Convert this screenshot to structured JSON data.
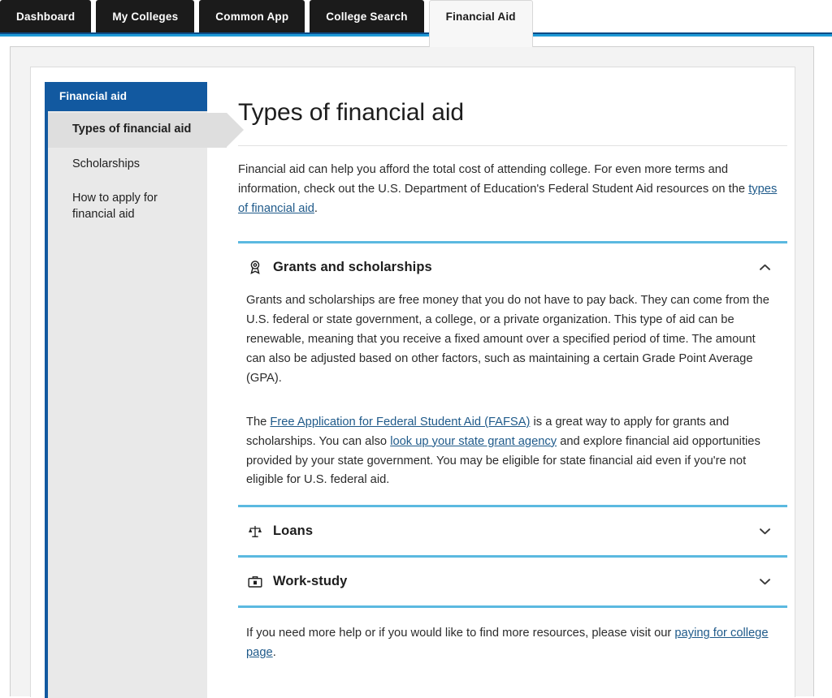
{
  "tabs": [
    {
      "label": "Dashboard",
      "active": false
    },
    {
      "label": "My Colleges",
      "active": false
    },
    {
      "label": "Common App",
      "active": false
    },
    {
      "label": "College Search",
      "active": false
    },
    {
      "label": "Financial Aid",
      "active": true
    }
  ],
  "sidebar": {
    "header": "Financial aid",
    "items": [
      {
        "label": "Types of financial aid",
        "active": true
      },
      {
        "label": "Scholarships",
        "active": false
      },
      {
        "label": "How to apply for financial aid",
        "active": false
      }
    ]
  },
  "main": {
    "title": "Types of financial aid",
    "intro": {
      "before": "Financial aid can help you afford the total cost of attending college. For even more terms and information, check out the U.S. Department of Education's Federal Student Aid resources on the ",
      "link": "types of financial aid",
      "after": "."
    },
    "accordion": [
      {
        "id": "grants-and-scholarships",
        "title": "Grants and scholarships",
        "icon": "award-medal-icon",
        "expanded": true,
        "chevron": "chevron-up-icon",
        "paragraph1": "Grants and scholarships are free money that you do not have to pay back. They can come from the U.S. federal or state government, a college, or a private organization. This type of aid can be renewable, meaning that you receive a fixed amount over a specified period of time. The amount can also be adjusted based on other factors, such as maintaining a certain Grade Point Average (GPA).",
        "paragraph2": {
          "part1": "The ",
          "link1": "Free Application for Federal Student Aid (FAFSA)",
          "part2": " is a great way to apply for grants and scholarships. You can also ",
          "link2": "look up your state grant agency",
          "part3": " and explore financial aid opportunities provided by your state government. You may be eligible for state financial aid even if you're not eligible for U.S. federal aid."
        }
      },
      {
        "id": "loans",
        "title": "Loans",
        "icon": "balance-scale-icon",
        "expanded": false,
        "chevron": "chevron-down-icon"
      },
      {
        "id": "work-study",
        "title": "Work-study",
        "icon": "briefcase-icon",
        "expanded": false,
        "chevron": "chevron-down-icon"
      }
    ],
    "footer": {
      "before": "If you need more help or if you would like to find more resources, please visit our ",
      "link": "paying for college page",
      "after": "."
    }
  },
  "colors": {
    "brand_blue": "#1259a0",
    "accent_blue": "#1f9ad6",
    "divider_blue": "#5bb9e0",
    "link": "#1f5a8a",
    "tab_dark": "#1b1b1b",
    "sidebar_bg": "#e9e9e9",
    "sidebar_active_bg": "#dedede"
  }
}
